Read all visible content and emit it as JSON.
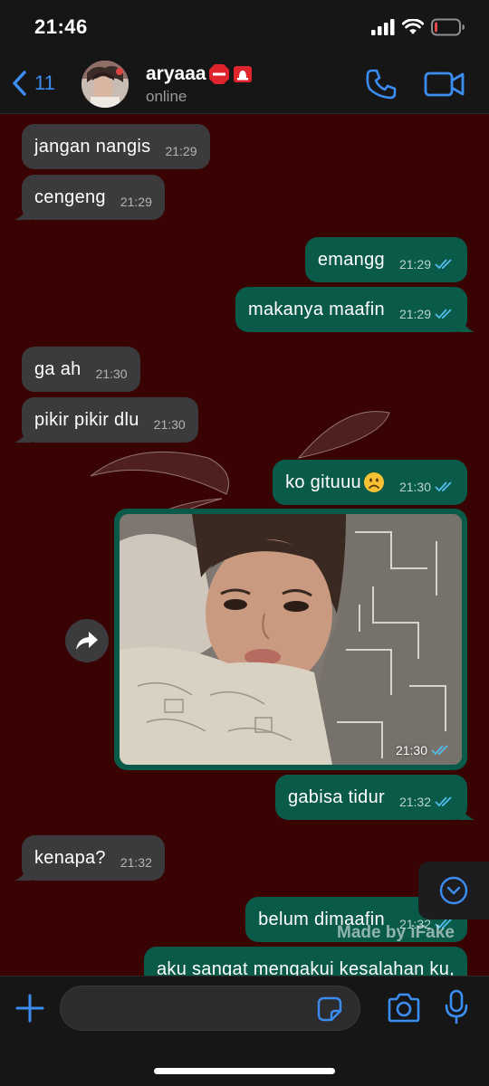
{
  "status_bar": {
    "time": "21:46",
    "battery_level": 0.12,
    "battery_color": "#e5484d"
  },
  "header": {
    "back_count": "11",
    "contact_name": "aryaaa",
    "contact_status": "online",
    "name_emojis": [
      "stop-sign-icon",
      "siren-icon"
    ],
    "accent_color": "#3b8df2"
  },
  "messages": [
    {
      "direction": "in",
      "text": "jangan nangis",
      "time": "21:29"
    },
    {
      "direction": "in",
      "text": "cengeng",
      "time": "21:29"
    },
    {
      "direction": "out",
      "text": "emangg",
      "time": "21:29",
      "read": true
    },
    {
      "direction": "out",
      "text": "makanya maafin",
      "time": "21:29",
      "read": true
    },
    {
      "direction": "in",
      "text": "ga ah",
      "time": "21:30"
    },
    {
      "direction": "in",
      "text": "pikir pikir dlu",
      "time": "21:30"
    },
    {
      "direction": "out",
      "text": "ko gituuu",
      "emoji": "frowning-face-icon",
      "time": "21:30",
      "read": true
    },
    {
      "direction": "out",
      "type": "photo",
      "time": "21:30",
      "read": true
    },
    {
      "direction": "out",
      "text": "gabisa tidur",
      "time": "21:32",
      "read": true
    },
    {
      "direction": "in",
      "text": "kenapa?",
      "time": "21:32"
    },
    {
      "direction": "out",
      "text": "belum dimaafin",
      "time": "21:32",
      "read": true
    },
    {
      "direction": "out",
      "text": "aku sangat mengakui kesalahan ku,",
      "time": "",
      "read": true
    }
  ],
  "watermark": "Made by iFake",
  "input": {
    "placeholder": "",
    "value": ""
  },
  "colors": {
    "chat_background": "#3a0303",
    "incoming_bubble": "#3b3b3d",
    "outgoing_bubble": "#0a5a4a",
    "read_tick": "#53bdeb"
  }
}
